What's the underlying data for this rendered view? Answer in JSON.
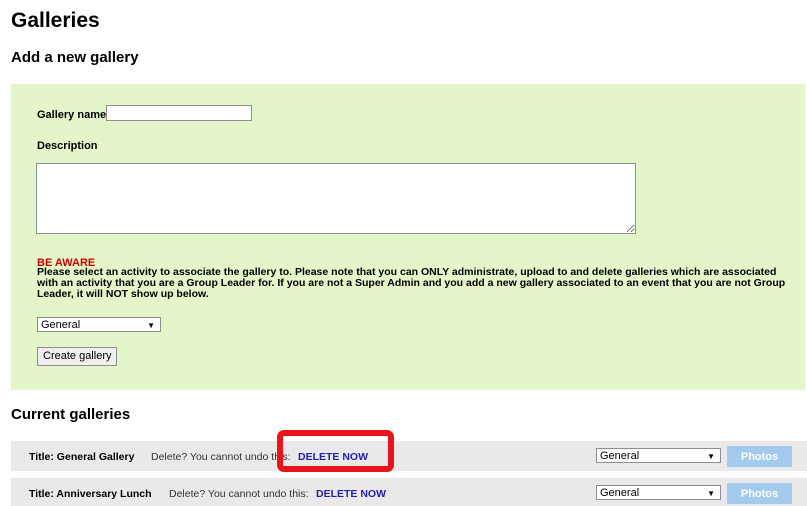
{
  "page": {
    "title": "Galleries"
  },
  "add_section": {
    "title": "Add a new gallery",
    "name_label": "Gallery name",
    "name_value": "",
    "description_label": "Description",
    "description_value": "",
    "aware_title": "BE AWARE",
    "aware_text": "Please select an activity to associate the gallery to. Please note that you can ONLY administrate, upload to and delete galleries which are associated with an activity that you are a Group Leader for. If you are not a Super Admin and you add a new gallery associated to an event that you are not Group Leader, it will NOT show up below.",
    "activity_selected": "General",
    "create_button_label": "Create gallery"
  },
  "current_section": {
    "title": "Current galleries",
    "rows": [
      {
        "title": "Title: General Gallery",
        "delete_text": "Delete? You cannot undo this:",
        "delete_link": "DELETE NOW",
        "activity": "General",
        "photos_label": "Photos"
      },
      {
        "title": "Title: Anniversary Lunch",
        "delete_text": "Delete? You cannot undo this:",
        "delete_link": "DELETE NOW",
        "activity": "General",
        "photos_label": "Photos"
      }
    ]
  },
  "icons": {
    "dropdown_arrow": "▼"
  },
  "colors": {
    "panel_background": "#e4f6c9",
    "aware_red": "#cc0000",
    "delete_link_blue": "#2222aa",
    "photos_button_blue": "#a3cbed",
    "highlight_red": "#e8141a",
    "row_background": "#e9e9e9"
  }
}
